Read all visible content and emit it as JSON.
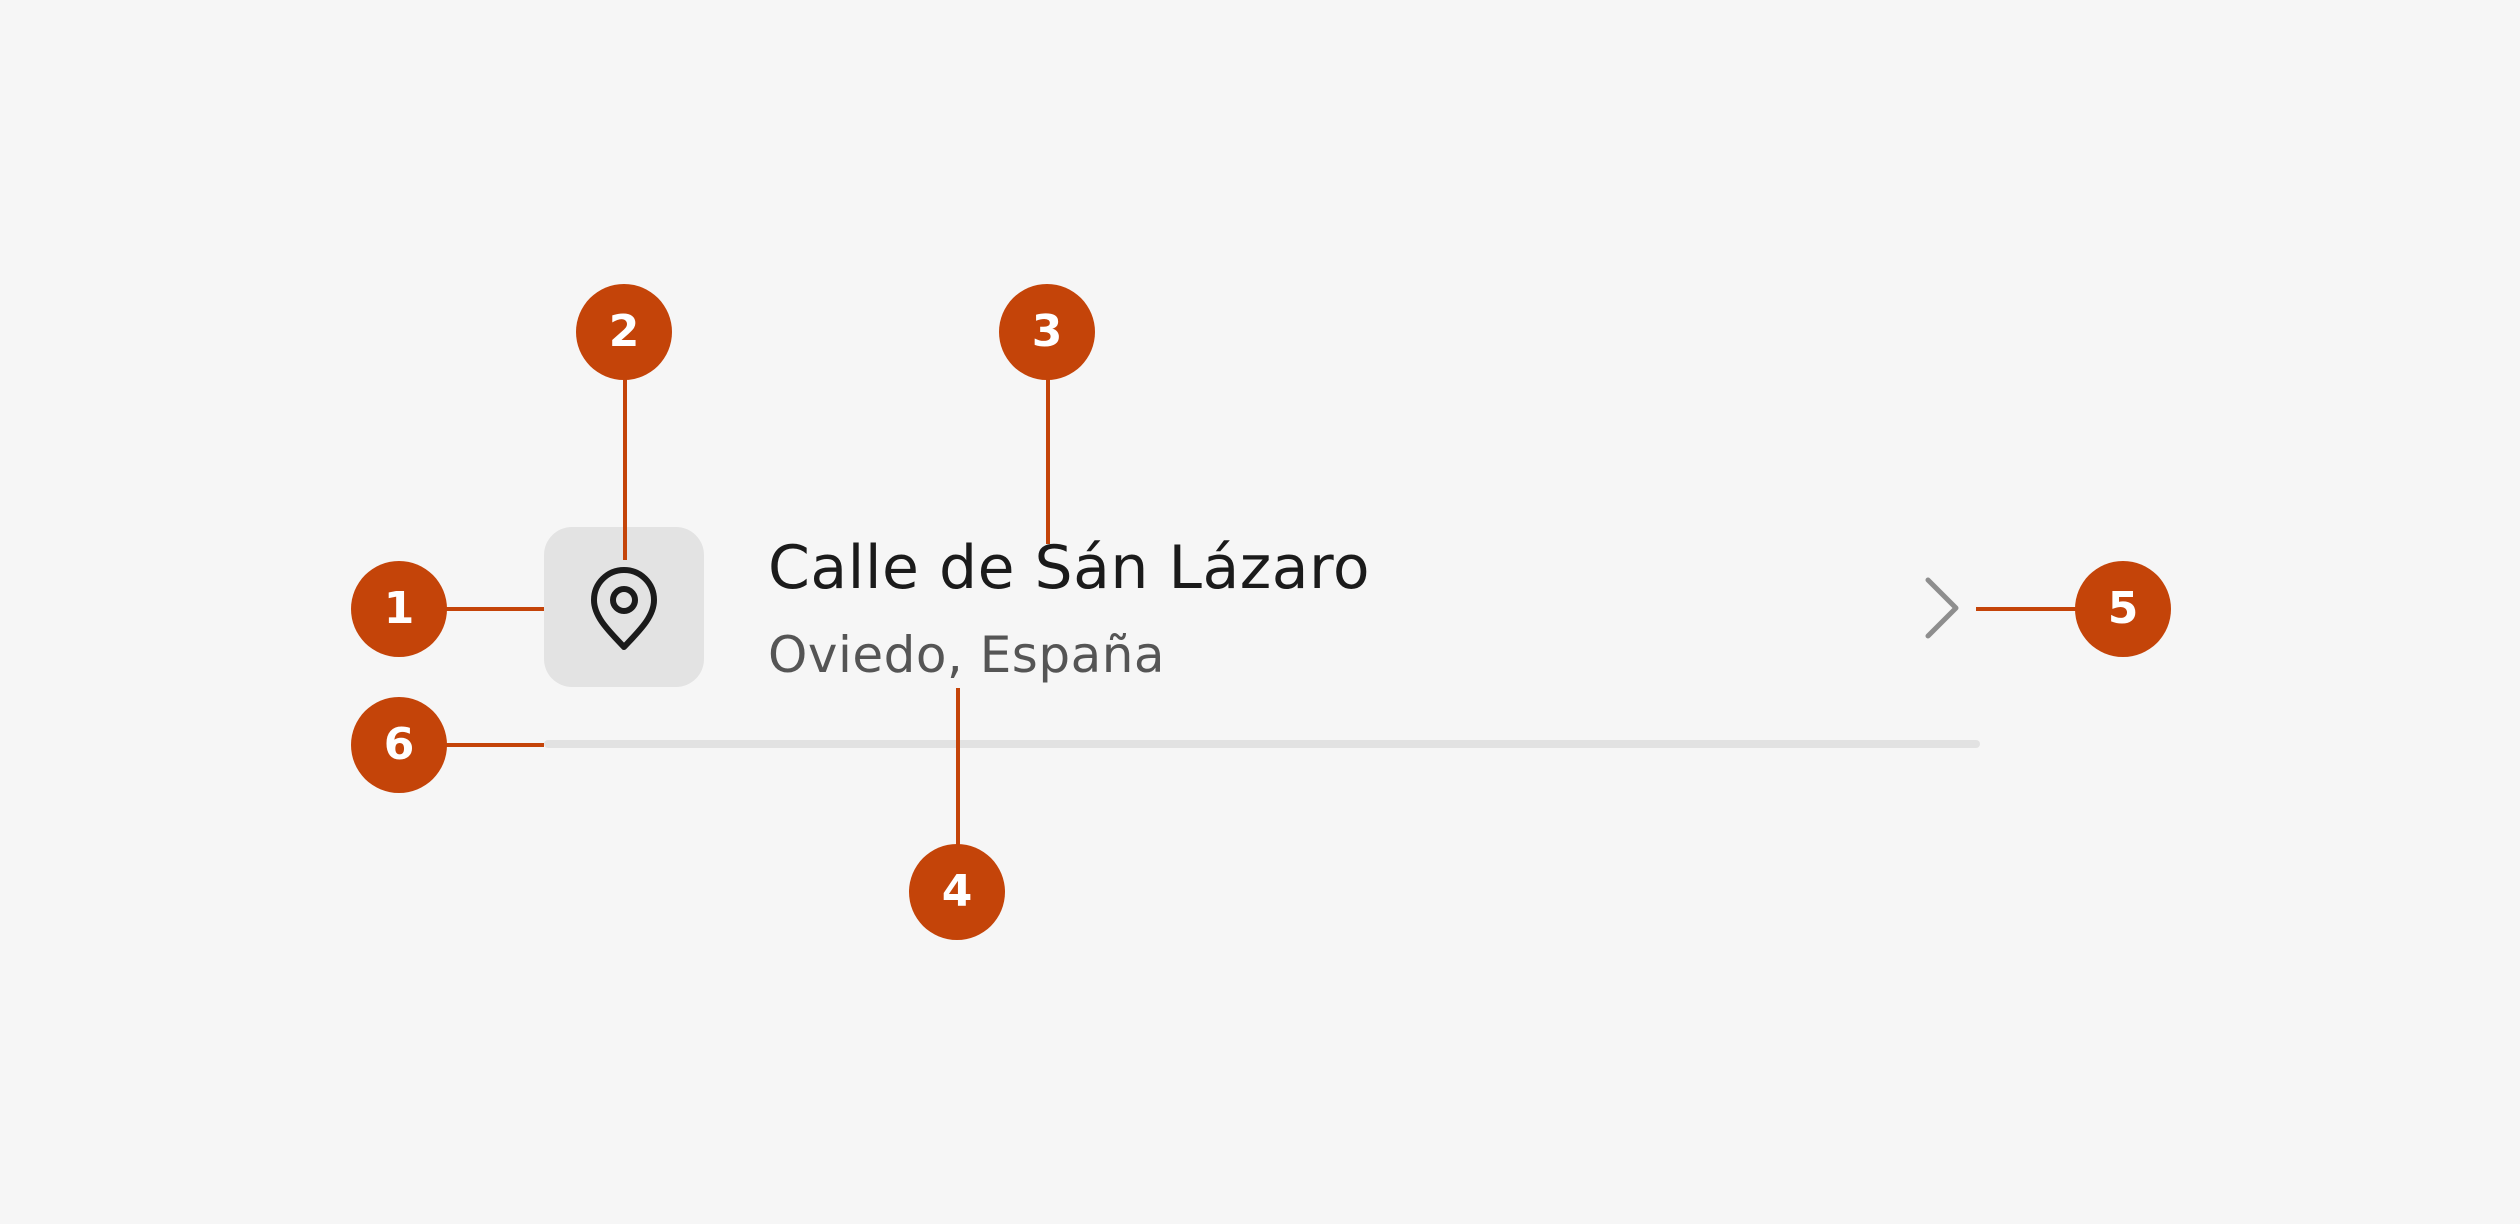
{
  "list_item": {
    "headline": "Calle de Sán Lázaro",
    "supporting_text": "Oviedo, España",
    "leading_icon": "location-pin-icon",
    "trailing_icon": "chevron-right-icon"
  },
  "annotations": [
    "1",
    "2",
    "3",
    "4",
    "5",
    "6"
  ],
  "colors": {
    "background": "#f6f6f6",
    "annotation": "#c44409",
    "thumbnail": "#e3e3e3",
    "headline": "#1b1b1b",
    "supporting": "#555555",
    "divider": "#e2e2e2"
  }
}
